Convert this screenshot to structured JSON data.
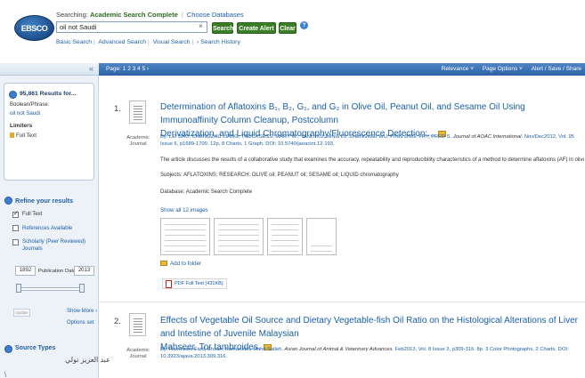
{
  "header": {
    "logo_text": "EBSCO",
    "searching_label": "Searching:",
    "database_name": "Academic Search Complete",
    "choose_databases": "Choose Databases",
    "search_value": "oil not Saudi",
    "search_button": "Search",
    "create_alert_button": "Create Alert",
    "clear_button": "Clear",
    "help_icon": "?",
    "links": [
      "Basic Search",
      "Advanced Search",
      "Visual Search",
      "› Search History"
    ]
  },
  "toolbar": {
    "pages": "Page: 1 2 3 4 5 ›",
    "relevance": "Relevance ˅",
    "page_options": "Page Options ˅",
    "alert_save_share": "Alert / Save / Share"
  },
  "sidebar": {
    "collapse": "«",
    "results_count": "95,861 Results for...",
    "boolean_label": "Boolean/Phrase:",
    "boolean_value": "oil not Saudi",
    "limiters_label": "Limiters",
    "limiters_value": "Full Text",
    "refine_label": "Refine your results",
    "checkboxes": [
      {
        "label": "Full Text",
        "checked": true
      },
      {
        "label": "References Available",
        "checked": false
      },
      {
        "label": "Scholarly (Peer Reviewed)",
        "checked": false
      },
      {
        "label": "Journals",
        "checked": false
      }
    ],
    "date_from": "1892",
    "pub_date_label": "Publication Date",
    "date_to": "2013",
    "update_button": "Update",
    "show_more": "Show More ›",
    "options_set": "Options set",
    "source_types": "Source Types",
    "overlay_text": "عبد العزيز تولي"
  },
  "results": [
    {
      "number": "1.",
      "type": "Academic Journal",
      "title_html_parts": {
        "pre": "Determination of Aflatoxins B",
        "b1": "1",
        "mid1": ", B",
        "b2": "2",
        "mid2": ", G",
        "g1": "1",
        "mid3": ", and G",
        "g2": "2",
        "rest": " in Olive "
      },
      "title_full": "Determination of Aflatoxins B1, B2, G1, and G2 in Olive Oil, Peanut Oil, and Sesame Oil Using Immunoaffinity Column Cleanup, Postcolumn Derivatization, and Liquid Chromatography/Fluorescence Detection:...",
      "title_line1": "Determination of Aflatoxins B₁, B₂, G₁, and G₂ in Olive Oil, Peanut Oil, and Sesame Oil Using Immunoaffinity Column Cleanup, Postcolumn",
      "title_line2": "Derivatization, and Liquid Chromatography/Fluorescence Detection:...",
      "authors": "By: LEI BAO; CHENGZHU LIANG; TRUCKSESS, MARY W.; YANLI XU; NING LV; ZHENGWEI WU; PING JING; FRY, FRED S.",
      "journal": "Journal of AOAC International.",
      "details": "Nov/Dec2012, Vol. 95 Issue 6, p1689-1700. 12p. 8 Charts, 1 Graph. DOI: 10.5740/jaoacint.12-193.",
      "abstract": "The article discusses the results of a collaborative study that examines the accuracy, repeatability and reproducibility characteristics of a method to determine aflatoxins (AF) in olive oil, pea...",
      "subjects": "Subjects: AFLATOXINS; RESEARCH; OLIVE oil; PEANUT oil; SESAME oil; LIQUID chromatography",
      "database": "Database: Academic Search Complete",
      "show_images": "Show all 12 images",
      "add_folder": "Add to folder",
      "pdf": "PDF Full Text (431KB)"
    },
    {
      "number": "2.",
      "type": "Academic Journal",
      "title_line1": "Effects of Vegetable Oil Source and Dietary Vegetable-fish Oil Ratio on the Histological Alterations of Liver and Intestine of Juvenile Malaysian",
      "title_line2": "Mahseer, Tor tambroides.",
      "authors": "By: Ramezani-Fard, Ehsan; Kamarudin, Mohd Salleh.",
      "journal": "Asian Journal of Animal & Veterinary Advances.",
      "details": "Feb2013, Vol. 8 Issue 2, p309-316. 8p. 3 Color Photographs, 2 Charts. DOI: 10.3923/ajava.2013.309.316."
    }
  ],
  "colors": {
    "toolbar": "#2c62a4",
    "link": "#1b5fa8",
    "button_green": "#3a7d26",
    "sidebar_bg": "#edf2f8"
  }
}
